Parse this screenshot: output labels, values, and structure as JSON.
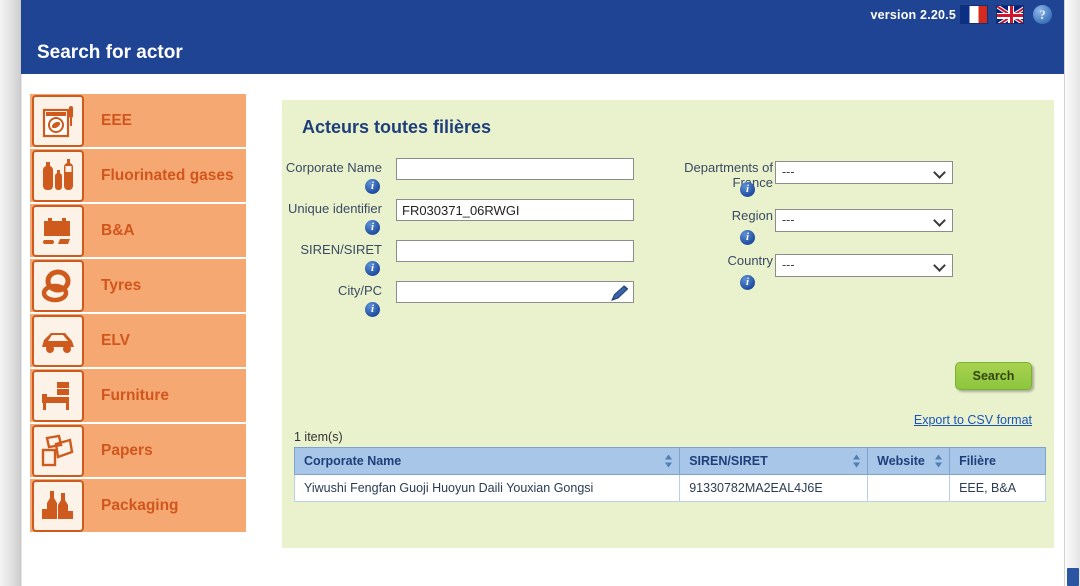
{
  "header": {
    "title": "Search for actor",
    "version": "version 2.20.5",
    "flag_fr": "french-flag",
    "flag_uk": "uk-flag",
    "help": "?"
  },
  "sidebar": {
    "items": [
      {
        "label": "EEE",
        "icon": "washing-machine-icon"
      },
      {
        "label": "Fluorinated gases",
        "icon": "gas-cylinders-icon"
      },
      {
        "label": "B&A",
        "icon": "battery-icon"
      },
      {
        "label": "Tyres",
        "icon": "tyre-icon"
      },
      {
        "label": "ELV",
        "icon": "car-icon"
      },
      {
        "label": "Furniture",
        "icon": "bed-icon"
      },
      {
        "label": "Papers",
        "icon": "papers-icon"
      },
      {
        "label": "Packaging",
        "icon": "bottles-icon"
      }
    ]
  },
  "panel": {
    "title": "Acteurs toutes filières",
    "form": {
      "left": [
        {
          "label": "Corporate Name",
          "value": "",
          "placeholder": ""
        },
        {
          "label": "Unique identifier",
          "value": "FR030371_06RWGI",
          "placeholder": ""
        },
        {
          "label": "SIREN/SIRET",
          "value": "",
          "placeholder": ""
        },
        {
          "label": "City/PC",
          "value": "",
          "placeholder": ""
        }
      ],
      "right": [
        {
          "label": "Departments of France",
          "value": "---"
        },
        {
          "label": "Region",
          "value": "---"
        },
        {
          "label": "Country",
          "value": "---"
        }
      ]
    },
    "search_button": "Search",
    "export_link": "Export to CSV format",
    "result_count": "1 item(s)",
    "table": {
      "columns": [
        {
          "label": "Corporate Name",
          "sortable": true
        },
        {
          "label": "SIREN/SIRET",
          "sortable": true
        },
        {
          "label": "Website",
          "sortable": true
        },
        {
          "label": "Filière",
          "sortable": false
        }
      ],
      "rows": [
        {
          "corporate_name": "Yiwushi Fengfan Guoji Huoyun Daili Youxian Gongsi",
          "siren_siret": "91330782MA2EAL4J6E",
          "website": "",
          "filiere": "EEE, B&A"
        }
      ]
    }
  },
  "colors": {
    "header_blue": "#1f4493",
    "sidebar_orange": "#f6a873",
    "sidebar_text": "#d1561d",
    "panel_green": "#e9f2cd",
    "button_green": "#8cc63e",
    "link_blue": "#1a54b8",
    "table_header_blue": "#a8c6e8"
  }
}
